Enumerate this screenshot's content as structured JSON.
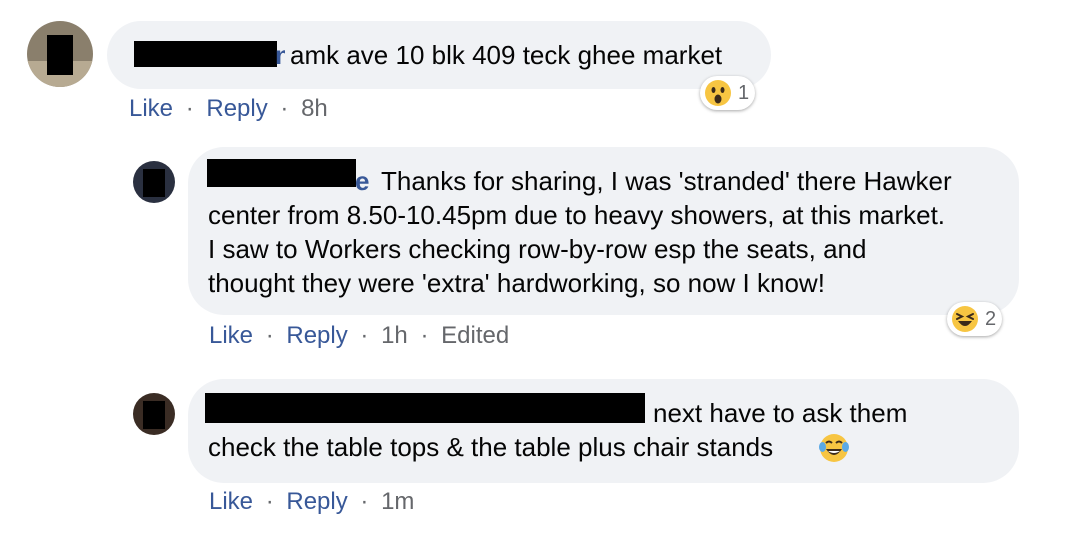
{
  "comments": [
    {
      "text": "amk ave 10 blk 409 teck ghee market",
      "name_tail": "n",
      "actions": {
        "like": "Like",
        "reply": "Reply",
        "time": "8h"
      },
      "reaction": {
        "icon": "wow-face-icon",
        "count": "1"
      }
    },
    {
      "text_lines": [
        "Thanks for sharing, I was 'stranded' there Hawker",
        "center from 8.50-10.45pm due to heavy showers, at this market.",
        "I saw to Workers checking row-by-row esp the seats, and",
        "thought they were 'extra' hardworking, so now I know!"
      ],
      "name_tail": "e",
      "actions": {
        "like": "Like",
        "reply": "Reply",
        "time": "1h",
        "edited": "Edited"
      },
      "reaction": {
        "icon": "laughing-squint-face-icon",
        "count": "2"
      }
    },
    {
      "text_lines": [
        "next have to ask them",
        "check the table tops & the table plus chair stands"
      ],
      "emoji": "tears-of-joy-emoji",
      "actions": {
        "like": "Like",
        "reply": "Reply",
        "time": "1m"
      }
    }
  ],
  "separator": "·",
  "colors": {
    "bubble": "#f0f2f5",
    "link": "#385898",
    "meta": "#65676b",
    "redaction": "#000000"
  }
}
